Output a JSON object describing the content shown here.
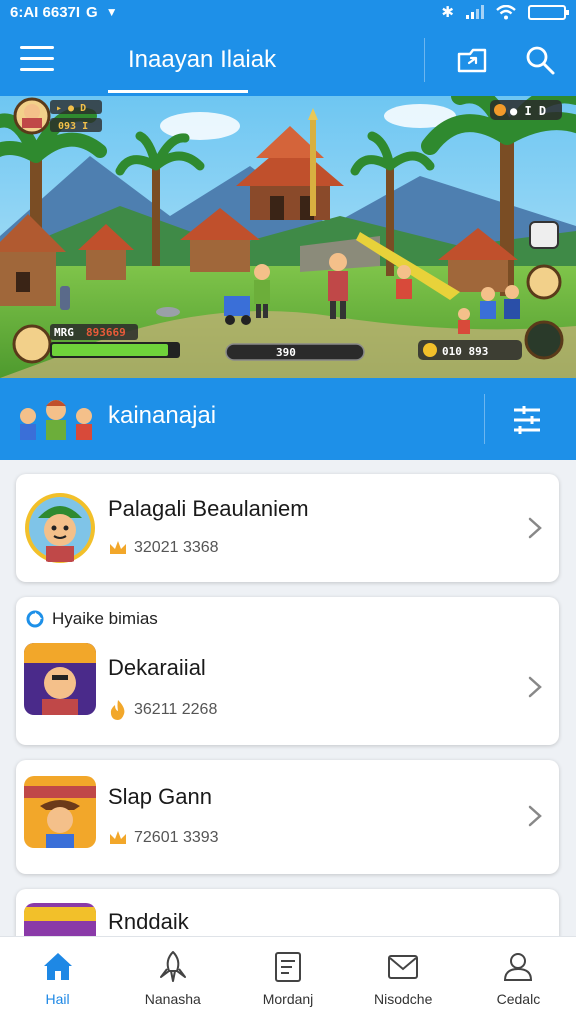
{
  "status_bar": {
    "time": "6:AI 6637I",
    "carrier_icon": "G"
  },
  "app_bar": {
    "title": "Inaayan Ilaiak"
  },
  "banner": {
    "top_badge": "▸ ● D",
    "top_score": "093 I",
    "right_counter": "● I D",
    "player_label": "MRG",
    "player_value": "893669",
    "center_value": "390",
    "coin_value": "010 893"
  },
  "section": {
    "title": "kainanajai"
  },
  "list": {
    "item1": {
      "name": "Palagali Beaulaniem",
      "score": "32021 3368"
    },
    "item2": {
      "promo_label": "Hyaike bimias",
      "name": "Dekaraiial",
      "score": "36211 2268"
    },
    "item3": {
      "name": "Slap Gann",
      "score": "72601 3393"
    },
    "item4": {
      "name": "Rnddaik"
    }
  },
  "bottom_nav": [
    {
      "label": "Hail",
      "icon": "home-icon",
      "active": true
    },
    {
      "label": "Nanasha",
      "icon": "rocket-icon",
      "active": false
    },
    {
      "label": "Mordanj",
      "icon": "document-icon",
      "active": false
    },
    {
      "label": "Nisodche",
      "icon": "mail-icon",
      "active": false
    },
    {
      "label": "Cedalc",
      "icon": "profile-icon",
      "active": false
    }
  ],
  "colors": {
    "accent": "#1e90e8",
    "nav_active": "#1e88e5",
    "card_bg": "#ffffff",
    "page_bg": "#eef1f5"
  }
}
